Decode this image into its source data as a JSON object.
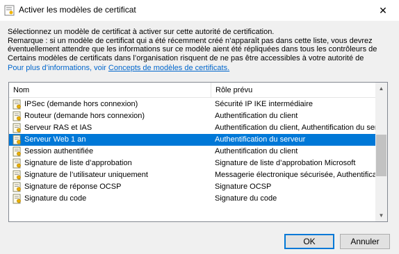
{
  "window": {
    "title": "Activer les modèles de certificat",
    "close_glyph": "✕"
  },
  "description": {
    "lines": [
      "Sélectionnez un modèle de certificat à activer sur cette autorité de certification.",
      "Remarque : si un modèle de certificat qui a été récemment créé n’apparaît pas dans cette liste, vous devrez",
      "éventuellement attendre que les informations sur ce modèle aient été répliquées dans tous les contrôleurs de",
      "Certains modèles de certificats dans l’organisation risquent de ne pas être accessibles à votre autorité de"
    ],
    "more_prefix": "Pour plus d’informations, voir ",
    "more_link": "Concepts de modèles de certificats."
  },
  "list": {
    "columns": [
      "Nom",
      "Rôle prévu"
    ],
    "rows": [
      {
        "name": "IPSec (demande hors connexion)",
        "role": "Sécurité IP IKE intermédiaire"
      },
      {
        "name": "Routeur (demande hors connexion)",
        "role": "Authentification du client"
      },
      {
        "name": "Serveur RAS et IAS",
        "role": "Authentification du client, Authentification du serv"
      },
      {
        "name": "Serveur Web 1 an",
        "role": "Authentification du serveur"
      },
      {
        "name": "Session authentifiée",
        "role": "Authentification du client"
      },
      {
        "name": "Signature de liste d’approbation",
        "role": "Signature de liste d’approbation Microsoft"
      },
      {
        "name": "Signature de l’utilisateur uniquement",
        "role": "Messagerie électronique sécurisée, Authentificatio"
      },
      {
        "name": "Signature de réponse OCSP",
        "role": "Signature OCSP"
      },
      {
        "name": "Signature du code",
        "role": "Signature du code"
      }
    ],
    "selected_index": 3,
    "scroll_position": 0.55
  },
  "buttons": {
    "ok": "OK",
    "cancel": "Annuler"
  },
  "colors": {
    "selection": "#0078d7",
    "link": "#0066cc",
    "dialog_bg": "#f0f0f0"
  }
}
